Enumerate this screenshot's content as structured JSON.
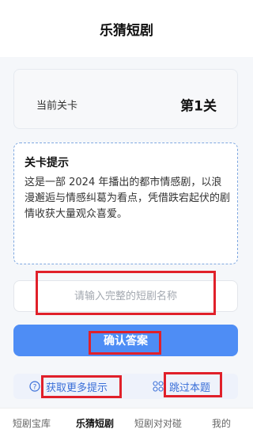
{
  "header": {
    "title": "乐猜短剧"
  },
  "level": {
    "label": "当前关卡",
    "value": "第1关"
  },
  "hint": {
    "title": "关卡提示",
    "text": "这是一部 2024 年播出的都市情感剧，以浪漫邂逅与情感纠葛为看点，凭借跌宕起伏的剧情收获大量观众喜爱。"
  },
  "answer": {
    "placeholder": "请输入完整的短剧名称",
    "value": ""
  },
  "actions": {
    "confirm_label": "确认答案",
    "more_hints_label": "获取更多提示",
    "more_hints_icon": "question-circle-icon",
    "skip_label": "跳过本题",
    "skip_icon": "grid-icon"
  },
  "tabs": [
    {
      "label": "短剧宝库",
      "active": false
    },
    {
      "label": "乐猜短剧",
      "active": true
    },
    {
      "label": "短剧对对碰",
      "active": false
    },
    {
      "label": "我的",
      "active": false
    }
  ],
  "colors": {
    "accent": "#4e8df5",
    "highlight": "#e0202a",
    "link": "#3a6fd8"
  }
}
